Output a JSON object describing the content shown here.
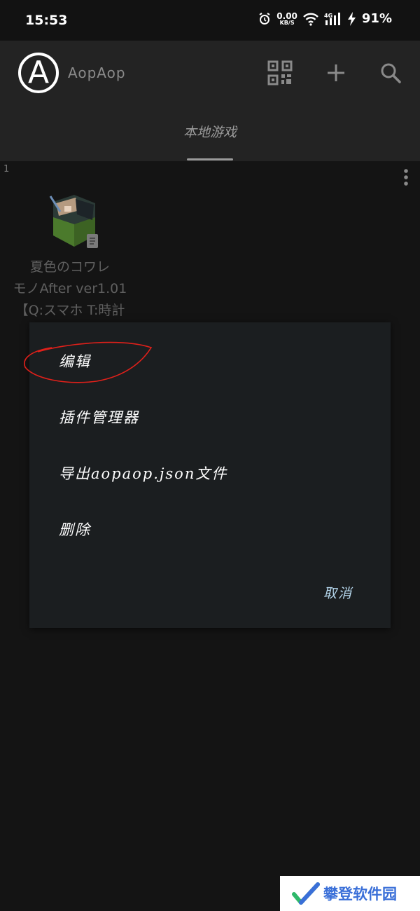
{
  "status": {
    "time": "15:53",
    "net_speed": "0.00",
    "net_unit": "KB/S",
    "network": "4G",
    "battery": "91%"
  },
  "appbar": {
    "avatar_letter": "A",
    "title": "AopAop"
  },
  "tabs": [
    {
      "label": "本地游戏"
    }
  ],
  "list": {
    "index": "1",
    "game": {
      "title_lines": [
        "夏色のコワレ",
        "モノAfter ver1.01",
        "【Q:スマホ T:時計"
      ]
    }
  },
  "dialog": {
    "options": [
      {
        "label": "编辑"
      },
      {
        "label": "插件管理器"
      },
      {
        "label": "导出aopaop.json文件"
      },
      {
        "label": "删除"
      }
    ],
    "cancel_label": "取消"
  },
  "watermark": {
    "text": "攀登软件园"
  },
  "colors": {
    "background": "#141414",
    "appbar": "#232323",
    "dialog": "#1b1e20",
    "accent": "#b6d8ee",
    "annotation": "#e0201a"
  }
}
